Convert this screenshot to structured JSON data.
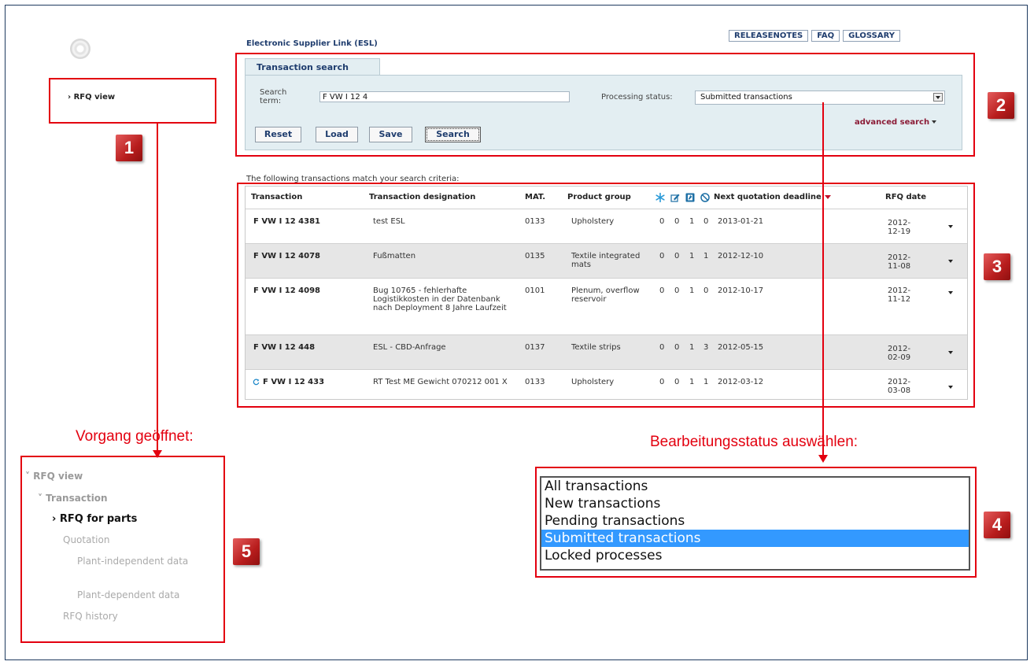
{
  "app": {
    "title": "Electronic Supplier Link (ESL)",
    "top_links": [
      "RELEASENOTES",
      "FAQ",
      "GLOSSARY"
    ]
  },
  "nav": {
    "rfq_view": "› RFQ view"
  },
  "search": {
    "tab": "Transaction search",
    "term_label": "Search term:",
    "term_value": "F VW I 12 4",
    "status_label": "Processing status:",
    "status_value": "Submitted transactions",
    "buttons": [
      "Reset",
      "Load",
      "Save",
      "Search"
    ],
    "advanced": "advanced search"
  },
  "results": {
    "intro": "The following transactions match your search criteria:",
    "headers": {
      "transaction": "Transaction",
      "designation": "Transaction designation",
      "mat": "MAT.",
      "product_group": "Product group",
      "deadline": "Next quotation deadline",
      "rfq_date": "RFQ date"
    },
    "header_icons": [
      "asterisk-icon",
      "edit-icon",
      "document-icon",
      "blocked-icon"
    ],
    "rows": [
      {
        "transaction": "F VW I 12 4381",
        "designation": "test ESL",
        "mat": "0133",
        "group": "Upholstery",
        "c1": "0",
        "c2": "0",
        "c3": "1",
        "c4": "0",
        "deadline": "2013-01-21",
        "rfq": "2012-12-19"
      },
      {
        "transaction": "F VW I 12 4078",
        "designation": "Fußmatten",
        "mat": "0135",
        "group": "Textile integrated mats",
        "c1": "0",
        "c2": "0",
        "c3": "1",
        "c4": "1",
        "deadline": "2012-12-10",
        "rfq": "2012-11-08"
      },
      {
        "transaction": "F VW I 12 4098",
        "designation": "Bug 10765 - fehlerhafte Logistikkosten in der Datenbank nach Deployment 8 Jahre Laufzeit",
        "mat": "0101",
        "group": "Plenum, overflow reservoir",
        "c1": "0",
        "c2": "0",
        "c3": "1",
        "c4": "0",
        "deadline": "2012-10-17",
        "rfq": "2012-11-12"
      },
      {
        "transaction": "F VW I 12 448",
        "designation": "ESL - CBD-Anfrage",
        "mat": "0137",
        "group": "Textile strips",
        "c1": "0",
        "c2": "0",
        "c3": "1",
        "c4": "3",
        "deadline": "2012-05-15",
        "rfq": "2012-02-09"
      },
      {
        "transaction": "F VW I 12 433",
        "designation": "RT Test ME Gewicht 070212 001 X",
        "mat": "0133",
        "group": "Upholstery",
        "c1": "0",
        "c2": "0",
        "c3": "1",
        "c4": "1",
        "deadline": "2012-03-12",
        "rfq": "2012-03-08"
      }
    ]
  },
  "annotations": {
    "badges": [
      "1",
      "2",
      "3",
      "4",
      "5"
    ],
    "label_opened": "Vorgang geöffnet:",
    "label_status": "Bearbeitungsstatus auswählen:"
  },
  "tree": {
    "rfq_view": "˅ RFQ view",
    "transaction": "˅ Transaction",
    "rfq_parts": "› RFQ for parts",
    "quotation": "Quotation",
    "plant_independent": "Plant-independent data",
    "plant_dependent": "Plant-dependent data",
    "rfq_history": "RFQ history"
  },
  "dropdown_options": [
    "All transactions",
    "New transactions",
    "Pending transactions",
    "Submitted transactions",
    "Locked processes"
  ],
  "colors": {
    "annotation_red": "#e3000f",
    "brand_blue": "#1f3d6e",
    "selected": "#3399ff"
  }
}
